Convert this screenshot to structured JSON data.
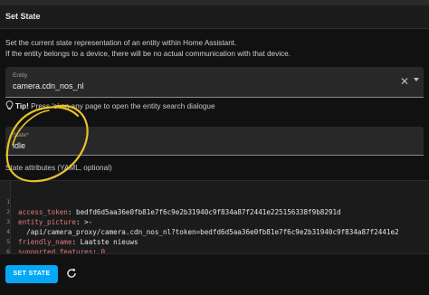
{
  "header": {
    "title": "Set State"
  },
  "description": {
    "line1": "Set the current state representation of an entity within Home Assistant.",
    "line2": "If the entity belongs to a device, there will be no actual communication with that device."
  },
  "entity_field": {
    "label": "Entity",
    "value": "camera.cdn_nos_nl"
  },
  "tip": {
    "strong": "Tip!",
    "text": " Press 'e' on any page to open the entity search dialogue"
  },
  "state_field": {
    "label": "State*",
    "value": "idle"
  },
  "attributes": {
    "label": "State attributes (YAML, optional)",
    "lines": [
      {
        "num": "1",
        "key": "access_token",
        "sep": ": ",
        "value": "bedfd6d5aa36e0fb81e7f6c9e2b31940c9f834a87f2441e225156338f9b8291d"
      },
      {
        "num": "2",
        "key": "entity_picture",
        "sep": ": ",
        "value": ">-"
      },
      {
        "num": "3",
        "key": "",
        "sep": "",
        "value": "  /api/camera_proxy/camera.cdn_nos_nl?token=bedfd6d5aa36e0fb81e7f6c9e2b31940c9f834a87f2441e2"
      },
      {
        "num": "4",
        "key": "friendly_name",
        "sep": ": ",
        "value": "Laatste nieuws"
      },
      {
        "num": "5",
        "key": "supported_features",
        "sep": ": ",
        "value": "0"
      },
      {
        "num": "6",
        "key": "",
        "sep": "",
        "value": ""
      }
    ]
  },
  "actions": {
    "set_state_label": "SET STATE"
  },
  "icons": {
    "clear": "close-icon",
    "dropdown": "chevron-down-icon",
    "tip": "lightbulb-icon",
    "refresh": "refresh-icon"
  },
  "colors": {
    "accent": "#03a9f4",
    "yaml_key": "#e2797a",
    "annotation": "#e8c22a",
    "background": "#111111"
  }
}
